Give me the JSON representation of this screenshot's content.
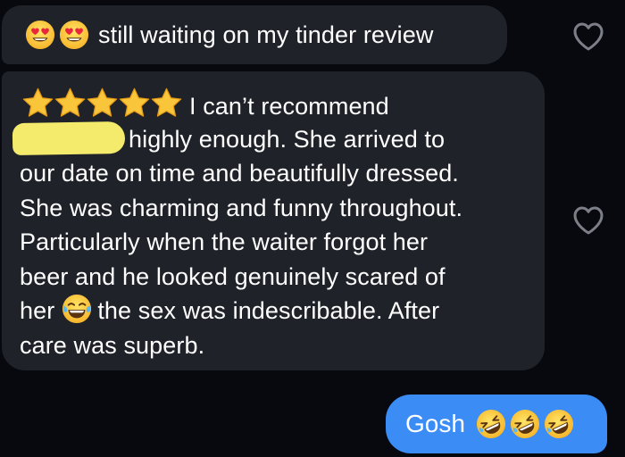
{
  "conversation": {
    "messages": [
      {
        "sender": "them",
        "emojis": [
          "smiling-face-with-heart-eyes",
          "smiling-face-with-heart-eyes"
        ],
        "text": "still waiting on my tinder review",
        "liked": false
      },
      {
        "sender": "them",
        "star_rating": 5,
        "lines": [
          "I can’t recommend",
          "highly enough. She arrived to",
          "our date on time and beautifully dressed.",
          "She was charming and funny throughout.",
          "Particularly when the waiter forgot her",
          "beer and he looked genuinely scared of",
          "her",
          "the sex was indescribable. After",
          "care was superb."
        ],
        "inline_emoji": "face-with-tears-of-joy",
        "redacted_name": true,
        "liked": false
      },
      {
        "sender": "me",
        "text": "Gosh",
        "emojis": [
          "rolling-on-the-floor-laughing",
          "rolling-on-the-floor-laughing",
          "rolling-on-the-floor-laughing"
        ]
      }
    ]
  },
  "icons": {
    "like": "heart-outline-icon",
    "star": "star-icon"
  },
  "colors": {
    "background": "#07090f",
    "incoming_bubble": "#1f2229",
    "outgoing_bubble": "#3b8cf5",
    "text": "#ffffff",
    "star": "#f9c53a",
    "redaction": "#f4ea6b",
    "heart_outline": "#7c7f87"
  }
}
